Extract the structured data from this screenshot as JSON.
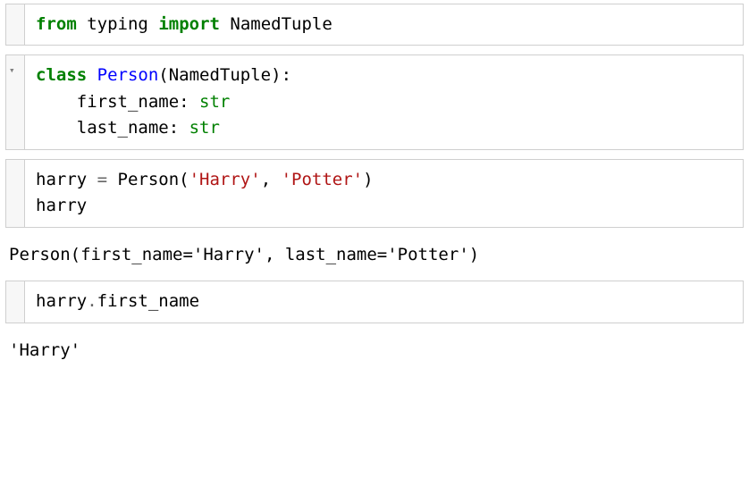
{
  "cells": [
    {
      "collapsible": false,
      "tokens": [
        {
          "t": "from",
          "c": "kw"
        },
        {
          "t": " ",
          "c": "pln"
        },
        {
          "t": "typing",
          "c": "pln"
        },
        {
          "t": " ",
          "c": "pln"
        },
        {
          "t": "import",
          "c": "kw"
        },
        {
          "t": " ",
          "c": "pln"
        },
        {
          "t": "NamedTuple",
          "c": "pln"
        }
      ]
    },
    {
      "collapsible": true,
      "tokens": [
        {
          "t": "class",
          "c": "kw"
        },
        {
          "t": " ",
          "c": "pln"
        },
        {
          "t": "Person",
          "c": "cls"
        },
        {
          "t": "(NamedTuple):",
          "c": "pln"
        },
        {
          "t": "\n    first_name: ",
          "c": "pln"
        },
        {
          "t": "str",
          "c": "typ"
        },
        {
          "t": "\n    last_name: ",
          "c": "pln"
        },
        {
          "t": "str",
          "c": "typ"
        }
      ]
    },
    {
      "collapsible": false,
      "tokens": [
        {
          "t": "harry ",
          "c": "pln"
        },
        {
          "t": "=",
          "c": "op"
        },
        {
          "t": " Person(",
          "c": "pln"
        },
        {
          "t": "'Harry'",
          "c": "str"
        },
        {
          "t": ", ",
          "c": "pln"
        },
        {
          "t": "'Potter'",
          "c": "str"
        },
        {
          "t": ")\nharry",
          "c": "pln"
        }
      ],
      "output": "Person(first_name='Harry', last_name='Potter')"
    },
    {
      "collapsible": false,
      "tokens": [
        {
          "t": "harry",
          "c": "pln"
        },
        {
          "t": ".",
          "c": "op"
        },
        {
          "t": "first_name",
          "c": "pln"
        }
      ],
      "output": "'Harry'"
    }
  ],
  "arrow_glyph": "▾"
}
